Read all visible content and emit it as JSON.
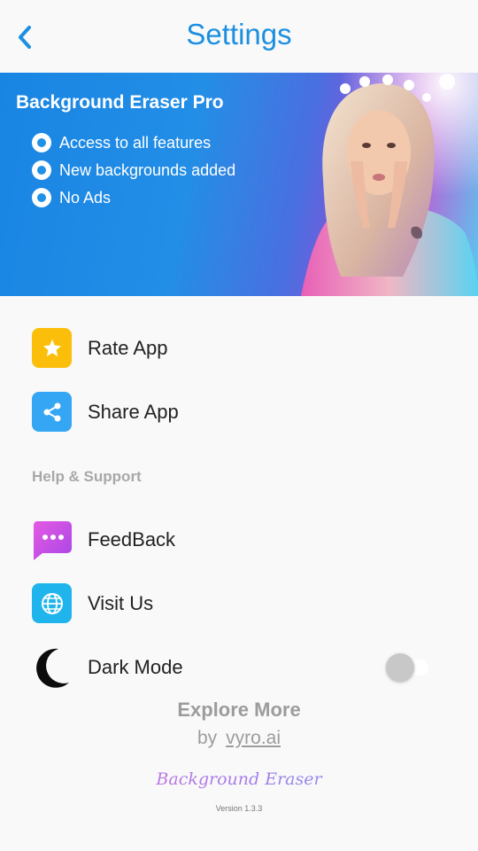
{
  "header": {
    "title": "Settings"
  },
  "banner": {
    "title": "Background Eraser Pro",
    "features": [
      "Access to all features",
      "New backgrounds added",
      "No Ads"
    ]
  },
  "menu": {
    "rate": "Rate App",
    "share": "Share App",
    "section_help": "Help & Support",
    "feedback": "FeedBack",
    "visit": "Visit Us",
    "dark_mode": "Dark Mode",
    "dark_mode_on": false
  },
  "footer": {
    "explore": "Explore More",
    "by": "by",
    "link": "vyro.ai",
    "brand": "Background Eraser",
    "version": "Version 1.3.3"
  },
  "colors": {
    "accent": "#1c8fe0",
    "rate_icon": "#fbbf0b",
    "share_icon": "#34a6f3",
    "feedback_icon": "#c44ee6",
    "visit_icon": "#1fb5ec"
  },
  "icons": [
    "back-arrow-icon",
    "star-icon",
    "share-icon",
    "chat-dots-icon",
    "globe-icon",
    "moon-icon"
  ]
}
